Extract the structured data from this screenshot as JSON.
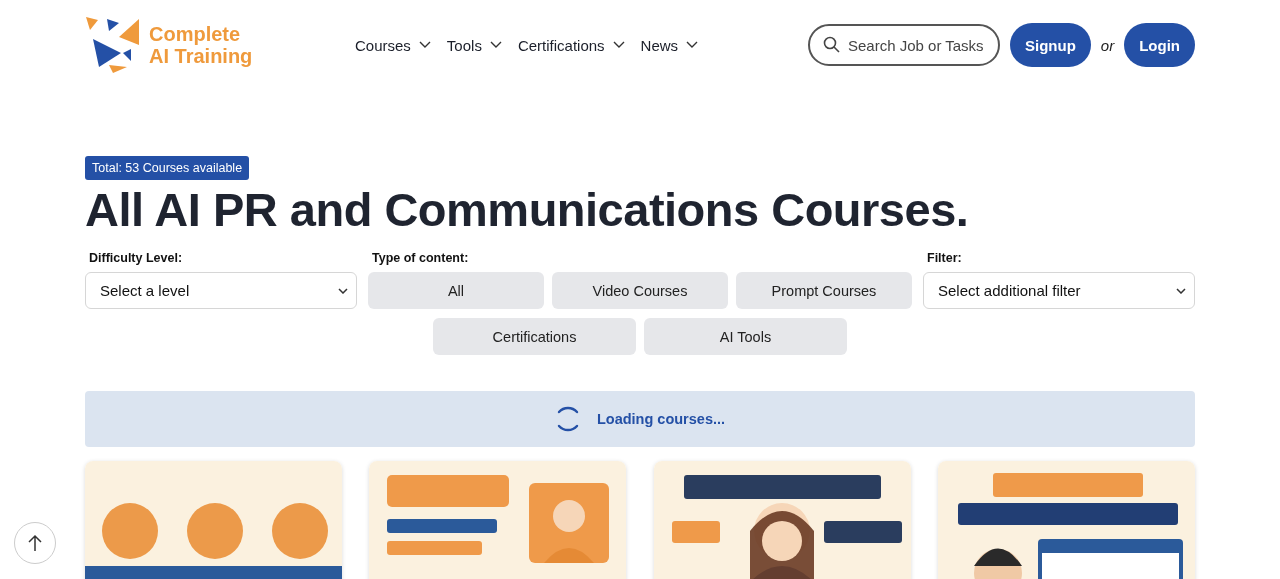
{
  "logo": {
    "line1": "Complete",
    "line2": "AI Training"
  },
  "nav": [
    {
      "label": "Courses"
    },
    {
      "label": "Tools"
    },
    {
      "label": "Certifications"
    },
    {
      "label": "News"
    }
  ],
  "search": {
    "placeholder": "Search Job or Tasks"
  },
  "auth": {
    "signup": "Signup",
    "separator": "or",
    "login": "Login"
  },
  "badge": "Total: 53 Courses available",
  "title": "All AI PR and Communications Courses.",
  "difficulty": {
    "label": "Difficulty Level:",
    "value": "Select a level"
  },
  "content_type": {
    "label": "Type of content:",
    "options": [
      {
        "label": "All",
        "selected": false
      },
      {
        "label": "Video Courses",
        "selected": false
      },
      {
        "label": "Prompt Courses",
        "selected": false
      },
      {
        "label": "Certifications",
        "selected": false
      },
      {
        "label": "AI Tools",
        "selected": false
      }
    ]
  },
  "filter": {
    "label": "Filter:",
    "value": "Select additional filter"
  },
  "loading": "Loading courses..."
}
